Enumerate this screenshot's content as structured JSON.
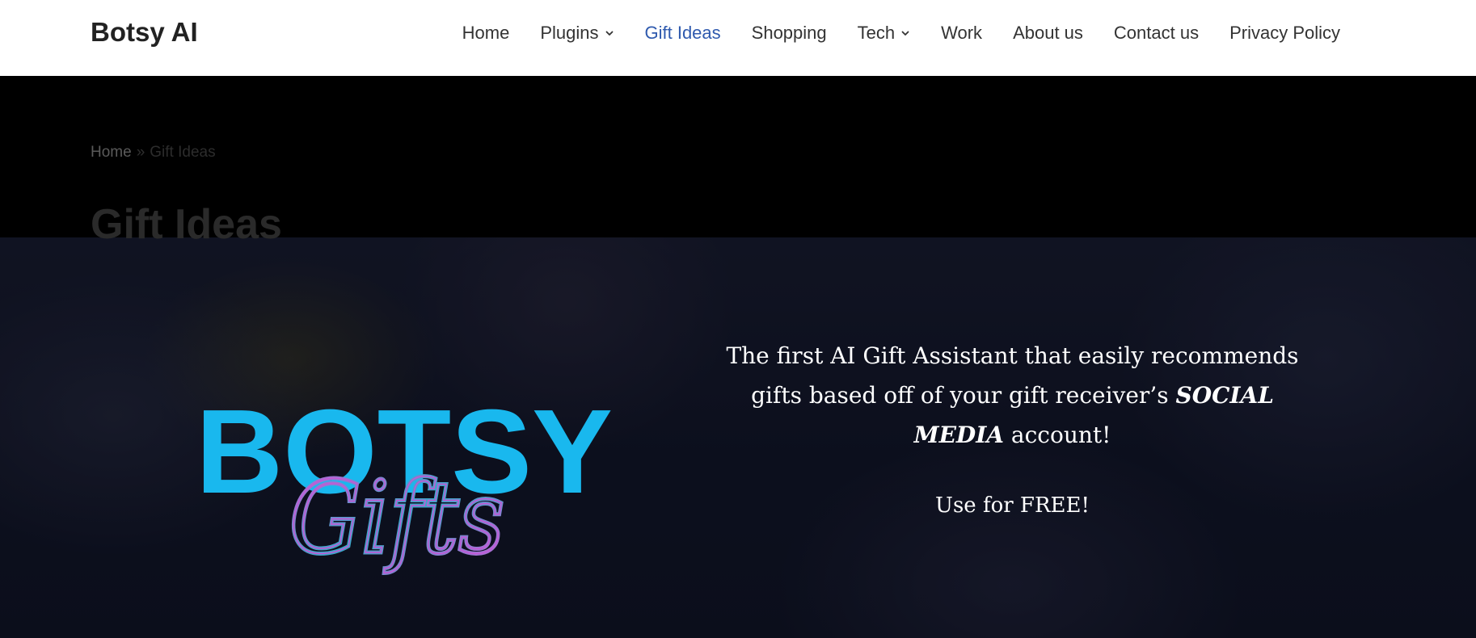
{
  "header": {
    "brand": "Botsy AI",
    "nav": [
      {
        "label": "Home",
        "has_dropdown": false,
        "active": false
      },
      {
        "label": "Plugins",
        "has_dropdown": true,
        "active": false
      },
      {
        "label": "Gift Ideas",
        "has_dropdown": false,
        "active": true
      },
      {
        "label": "Shopping",
        "has_dropdown": false,
        "active": false
      },
      {
        "label": "Tech",
        "has_dropdown": true,
        "active": false
      },
      {
        "label": "Work",
        "has_dropdown": false,
        "active": false
      },
      {
        "label": "About us",
        "has_dropdown": false,
        "active": false
      },
      {
        "label": "Contact us",
        "has_dropdown": false,
        "active": false
      },
      {
        "label": "Privacy Policy",
        "has_dropdown": false,
        "active": false
      }
    ]
  },
  "breadcrumb": {
    "home": "Home",
    "separator": "»",
    "current": "Gift Ideas"
  },
  "page_title": "Gift Ideas",
  "hero": {
    "logo": {
      "word": "BOTSY",
      "script": "Gifts"
    },
    "tagline_part1": "The first AI Gift Assistant that easily recommends gifts based off of your gift receiver’s ",
    "tagline_emphasis": "SOCIAL MEDIA",
    "tagline_part2": " account!",
    "cta": "Use for FREE!"
  },
  "colors": {
    "nav_active": "#2f5aae",
    "nav_text": "#333333",
    "title_band": "#000000",
    "hero_bg": "#121524",
    "logo_cyan": "#19b8ee",
    "logo_script_pink": "#d25ad8",
    "logo_script_teal": "#3aa7c9"
  },
  "icons": {
    "dropdown": "chevron-down-icon"
  }
}
